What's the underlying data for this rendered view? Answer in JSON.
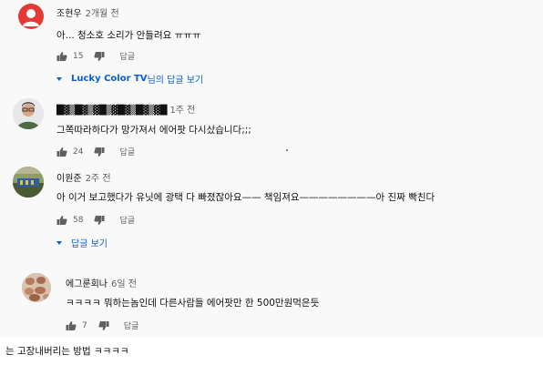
{
  "comments": [
    {
      "author": "조현우",
      "time": "2개월 전",
      "text": "아... 청소호 소리가 안들려요 ㅠㅠㅠ",
      "likes": "15",
      "reply_label": "답글",
      "avatar_color": "#e53935"
    },
    {
      "author": "█▓▒█▓▒▓█▒▓█▓▒█▓▒▓█",
      "time": "1주 전",
      "text": "그쪽따라하다가 망가져서 에어팟 다시샀습니다;;;",
      "likes": "24",
      "reply_label": "답글"
    },
    {
      "author": "이원준",
      "time": "2주 전",
      "text": "아 이거 보고했다가 유닛에 광택 다 빠졌잖아요—— 책임져요————————아 진짜 빡친다",
      "likes": "58",
      "reply_label": "답글"
    },
    {
      "author": "에그룬회나",
      "time": "6일 전",
      "text": "ㅋㅋㅋㅋ 뭐하는놈인데 다른사람들 에어팟만 한 500만원먹은듯",
      "likes": "7",
      "reply_label": "답글"
    }
  ],
  "view_replies_1": {
    "prefix": "Lucky Color TV",
    "suffix": "님의 답글 보기"
  },
  "view_replies_2": "답글 보기",
  "caption": "는 고장내버리는 방법 ㅋㅋㅋㅋ"
}
